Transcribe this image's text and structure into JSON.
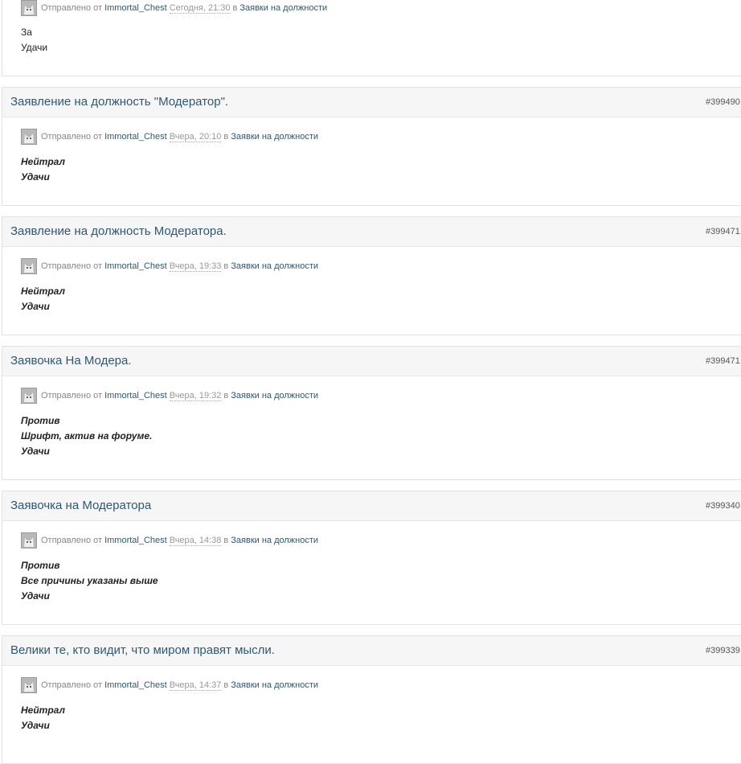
{
  "common": {
    "sent_by": "Отправлено от",
    "author": "Immortal_Chest",
    "in": "в",
    "category": "Заявки на должности"
  },
  "posts": [
    {
      "title": "",
      "id": "",
      "date": "Сегодня, 21:30",
      "lines": [
        "За",
        "Удачи"
      ]
    },
    {
      "title": "Заявление на должность \"Модератор\".",
      "id": "#399490",
      "date": "Вчера, 20:10",
      "lines": [
        "Нейтрал",
        "Удачи"
      ]
    },
    {
      "title": "Заявление на должность Модератора.",
      "id": "#399471",
      "date": "Вчера, 19:33",
      "lines": [
        "Нейтрал",
        "Удачи"
      ]
    },
    {
      "title": "Заявочка На Модера.",
      "id": "#399471",
      "date": "Вчера, 19:32",
      "lines": [
        "Против",
        "Шрифт, актив на форуме.",
        "Удачи"
      ]
    },
    {
      "title": "Заявочка на Модератора",
      "id": "#399340",
      "date": "Вчера, 14:38",
      "lines": [
        "Против",
        "Все причины указаны выше",
        "Удачи"
      ]
    },
    {
      "title": "Велики те, кто видит, что миром правят мысли.",
      "id": "#399339",
      "date": "Вчера, 14:37",
      "lines": [
        "Нейтрал",
        "Удачи"
      ]
    }
  ]
}
